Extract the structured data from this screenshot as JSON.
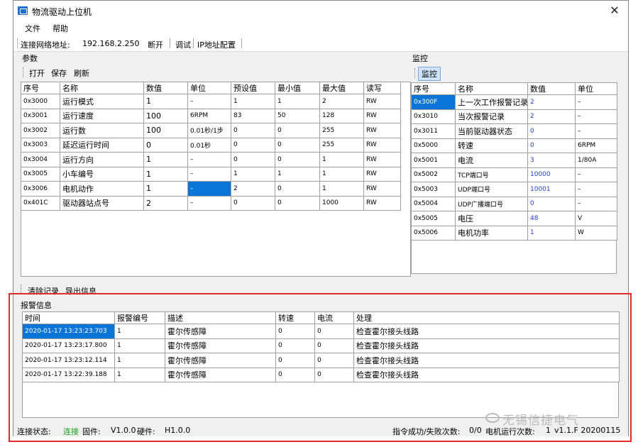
{
  "window": {
    "title": "物流驱动上位机",
    "close": "✕"
  },
  "menu": [
    "文件",
    "帮助"
  ],
  "connection": {
    "label": "连接网络地址:",
    "ip": "192.168.2.250",
    "disconnect": "断开",
    "debug": "调试",
    "ip_config": "IP地址配置"
  },
  "params": {
    "group": "参数",
    "toolbar": [
      "打开",
      "保存",
      "刷新"
    ],
    "columns": [
      "序号",
      "名称",
      "数值",
      "单位",
      "预设值",
      "最小值",
      "最大值",
      "读写"
    ],
    "rows": [
      [
        "0x3000",
        "运行模式",
        "1",
        "–",
        "1",
        "1",
        "2",
        "RW"
      ],
      [
        "0x3001",
        "运行速度",
        "100",
        "6RPM",
        "83",
        "50",
        "128",
        "RW"
      ],
      [
        "0x3002",
        "运行数",
        "100",
        "0.01秒/1步",
        "0",
        "0",
        "255",
        "RW"
      ],
      [
        "0x3003",
        "延迟运行时间",
        "0",
        "0.01秒",
        "0",
        "0",
        "255",
        "RW"
      ],
      [
        "0x3004",
        "运行方向",
        "1",
        "–",
        "0",
        "0",
        "1",
        "RW"
      ],
      [
        "0x3005",
        "小车编号",
        "1",
        "–",
        "1",
        "1",
        "1",
        "RW"
      ],
      [
        "0x3006",
        "电机动作",
        "1",
        "–",
        "2",
        "0",
        "1",
        "RW"
      ],
      [
        "0x401C",
        "驱动器站点号",
        "2",
        "–",
        "0",
        "0",
        "1000",
        "RW"
      ]
    ]
  },
  "monitor": {
    "group": "监控",
    "button": "监控",
    "columns": [
      "序号",
      "名称",
      "数值",
      "单位"
    ],
    "rows": [
      [
        "0x300F",
        "上一次工作报警记录",
        "2",
        "–"
      ],
      [
        "0x3010",
        "当次报警记录",
        "2",
        "–"
      ],
      [
        "0x3011",
        "当前驱动器状态",
        "0",
        "–"
      ],
      [
        "0x5000",
        "转速",
        "0",
        "6RPM"
      ],
      [
        "0x5001",
        "电流",
        "3",
        "1/80A"
      ],
      [
        "0x5002",
        "TCP端口号",
        "10000",
        "–"
      ],
      [
        "0x5003",
        "UDP端口号",
        "10001",
        "–"
      ],
      [
        "0x5004",
        "UDP广播端口号",
        "0",
        "–"
      ],
      [
        "0x5005",
        "电压",
        "48",
        "V"
      ],
      [
        "0x5006",
        "电机功率",
        "1",
        "W"
      ]
    ]
  },
  "alarm": {
    "toolbar": [
      "清除记录",
      "导出信息"
    ],
    "group": "报警信息",
    "columns": [
      "时间",
      "报警编号",
      "描述",
      "转速",
      "电流",
      "处理"
    ],
    "rows": [
      [
        "2020-01-17 13:23:23.703",
        "1",
        "霍尔传感障",
        "0",
        "0",
        "检查霍尔接头线路"
      ],
      [
        "2020-01-17 13:23:17.800",
        "1",
        "霍尔传感障",
        "0",
        "0",
        "检查霍尔接头线路"
      ],
      [
        "2020-01-17 13:23:12.114",
        "1",
        "霍尔传感障",
        "0",
        "0",
        "检查霍尔接头线路"
      ],
      [
        "2020-01-17 13:22:39.188",
        "1",
        "霍尔传感障",
        "0",
        "0",
        "检查霍尔接头线路"
      ]
    ]
  },
  "status": {
    "conn_label": "连接状态:",
    "conn_value": "连接",
    "fw_label": "固件:",
    "fw_value": "V1.0.0",
    "hw_label": "硬件:",
    "hw_value": "H1.0.0",
    "cmd_label": "指令成功/失败次数:",
    "cmd_value": "0/0",
    "run_label": "电机运行次数:",
    "run_value": "1",
    "version": "v1.1.F 20200115"
  },
  "watermark": "无锡信捷电气",
  "colors": {
    "selection": "#0a75d6",
    "connected": "#1b9e1b",
    "highlight_border": "#e32a2a",
    "value_blue": "#1f3fd8"
  }
}
